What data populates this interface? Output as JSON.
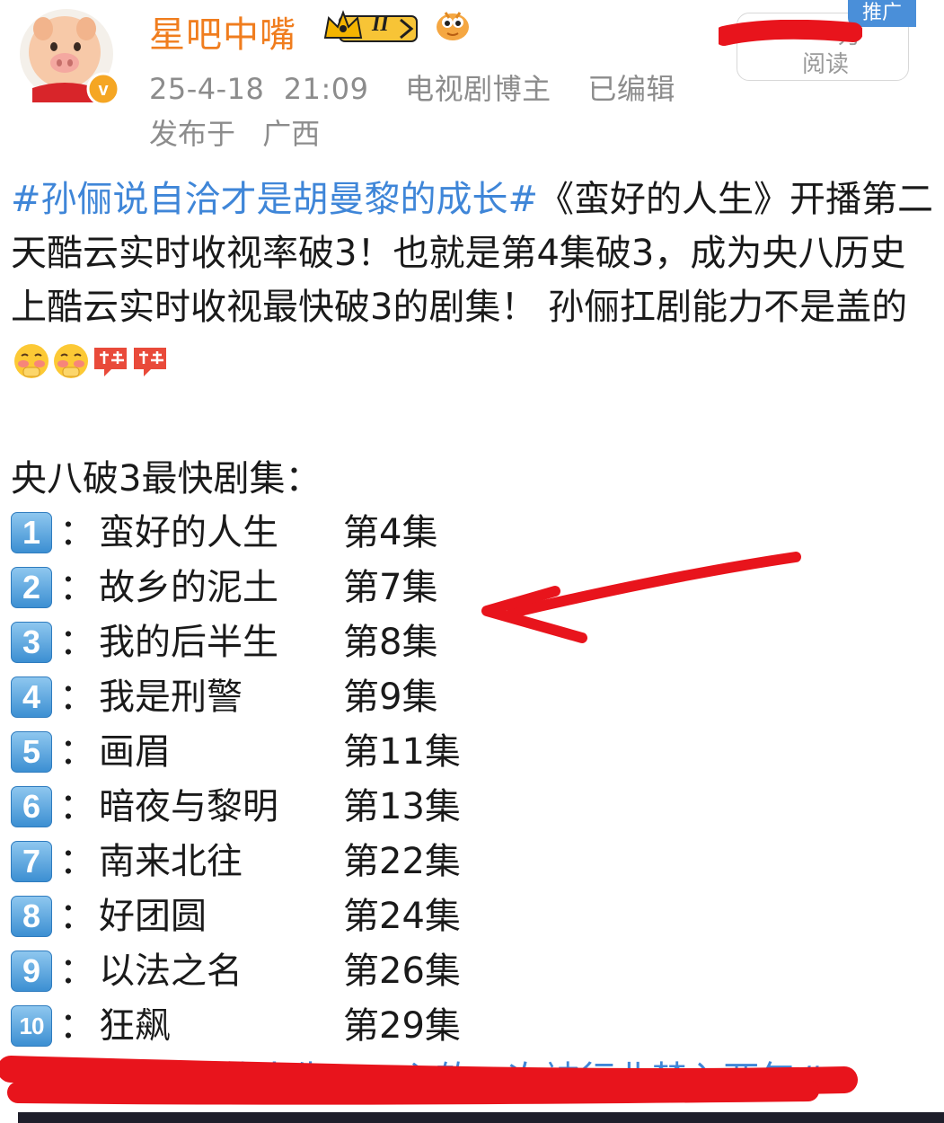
{
  "user": {
    "name": "星吧中嘴",
    "level_badge": "II",
    "avatar_icon": "cartoon-pig-avatar",
    "verified_icon": "verified-v-badge"
  },
  "meta": {
    "datetime": "25-4-18  21:09",
    "role": "电视剧博主",
    "edited": "已编辑",
    "location_prefix": "发布于",
    "location": "广西"
  },
  "read_box": {
    "count": "万",
    "label": "阅读",
    "promo_tag": "推广"
  },
  "post": {
    "hashtag": "#孙俪说自洽才是胡曼黎的成长#",
    "body": "《蛮好的人生》开播第二天酷云实时收视率破3！也就是第4集破3，成为央八历史上酷云实时收视最快破3的剧集！  孙俪扛剧能力不是盖的",
    "emojis": [
      "shy-face-emoji",
      "shy-face-emoji",
      "dong-sticker-emoji",
      "dong-sticker-emoji"
    ]
  },
  "list": {
    "title": "央八破3最快剧集：",
    "items": [
      {
        "num": "1",
        "name": "蛮好的人生",
        "episode": "第4集"
      },
      {
        "num": "2",
        "name": "故乡的泥土",
        "episode": "第7集"
      },
      {
        "num": "3",
        "name": "我的后半生",
        "episode": "第8集"
      },
      {
        "num": "4",
        "name": "我是刑警",
        "episode": "第9集"
      },
      {
        "num": "5",
        "name": "画眉",
        "episode": "第11集"
      },
      {
        "num": "6",
        "name": "暗夜与黎明",
        "episode": "第13集"
      },
      {
        "num": "7",
        "name": "南来北往",
        "episode": "第22集"
      },
      {
        "num": "8",
        "name": "好团圆",
        "episode": "第24集"
      },
      {
        "num": "9",
        "name": "以法之名",
        "episode": "第26集"
      },
      {
        "num": "10",
        "name": "狂飙",
        "episode": "第29集"
      }
    ]
  },
  "bottom_tags": "#电视剧蛮好的人生#  #心软一次被行业禁入两年#",
  "colors": {
    "username": "#f07d1e",
    "hashtag": "#3f86d8",
    "meta": "#8c8c8c",
    "redaction": "#e8141c",
    "promo": "#4a8fd9"
  }
}
